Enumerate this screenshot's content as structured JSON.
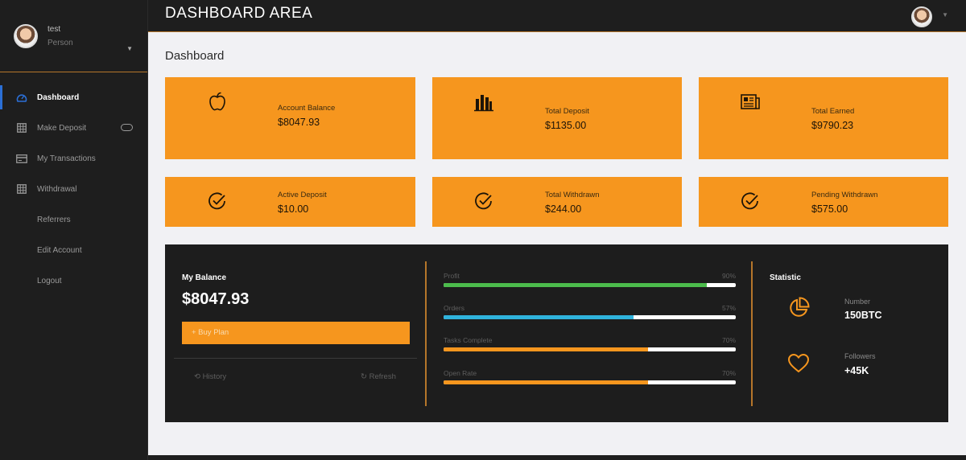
{
  "sidebar": {
    "user": {
      "name": "test",
      "role": "Person"
    },
    "items": [
      {
        "label": "Dashboard",
        "icon": "dashboard-icon",
        "active": true
      },
      {
        "label": "Make Deposit",
        "icon": "grid-icon"
      },
      {
        "label": "My Transactions",
        "icon": "card-icon"
      },
      {
        "label": "Withdrawal",
        "icon": "grid-icon"
      },
      {
        "label": "Referrers"
      },
      {
        "label": "Edit Account"
      },
      {
        "label": "Logout"
      }
    ]
  },
  "header": {
    "title": "DASHBOARD AREA"
  },
  "page_title": "Dashboard",
  "cards": [
    {
      "label": "Account Balance",
      "value": "$8047.93",
      "icon": "apple-icon"
    },
    {
      "label": "Total Deposit",
      "value": "$1135.00",
      "icon": "bar-chart-icon"
    },
    {
      "label": "Total Earned",
      "value": "$9790.23",
      "icon": "newspaper-icon"
    },
    {
      "label": "Active Deposit",
      "value": "$10.00",
      "icon": "check-circle-icon"
    },
    {
      "label": "Total Withdrawn",
      "value": "$244.00",
      "icon": "check-circle-icon"
    },
    {
      "label": "Pending Withdrawn",
      "value": "$575.00",
      "icon": "check-circle-icon"
    }
  ],
  "balance": {
    "title": "My Balance",
    "value": "$8047.93",
    "buy_label": "+ Buy Plan",
    "history_label": "History",
    "refresh_label": "Refresh"
  },
  "progress": [
    {
      "label": "Profit",
      "percent_text": "90%",
      "value": 90,
      "color": "#4cbc4c"
    },
    {
      "label": "Orders",
      "percent_text": "57%",
      "value": 65,
      "color": "#2fb3dc"
    },
    {
      "label": "Tasks Complete",
      "percent_text": "70%",
      "value": 70,
      "color": "#f6961e"
    },
    {
      "label": "Open Rate",
      "percent_text": "70%",
      "value": 70,
      "color": "#f6961e"
    }
  ],
  "statistic": {
    "title": "Statistic",
    "items": [
      {
        "label": "Number",
        "value": "150BTC",
        "icon": "pie-chart-icon"
      },
      {
        "label": "Followers",
        "value": "+45K",
        "icon": "heart-icon"
      }
    ]
  },
  "colors": {
    "accent": "#f6961e",
    "dark": "#1e1e1e",
    "active_indicator": "#2b6fd6"
  }
}
